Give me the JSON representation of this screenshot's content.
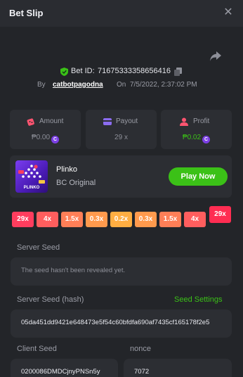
{
  "header": {
    "title": "Bet Slip"
  },
  "bet": {
    "id_label": "Bet ID:",
    "id_value": "71675333358656416",
    "by_label": "By",
    "user": "catbotpagodna",
    "on_label": "On",
    "date": "7/5/2022, 2:37:02 PM"
  },
  "stats": {
    "amount": {
      "label": "Amount",
      "value": "₱0.00"
    },
    "payout": {
      "label": "Payout",
      "value": "29 x"
    },
    "profit": {
      "label": "Profit",
      "value": "₱0.02"
    },
    "coin_glyph": "C"
  },
  "game": {
    "name": "Plinko",
    "provider": "BC Original",
    "play_label": "Play Now",
    "thumb_text": "PLINKO"
  },
  "multipliers": [
    {
      "label": "29x",
      "color": "#ff3d5e"
    },
    {
      "label": "4x",
      "color": "#ff5e5e"
    },
    {
      "label": "1.5x",
      "color": "#ff7f57"
    },
    {
      "label": "0.3x",
      "color": "#ff9a4d"
    },
    {
      "label": "0.2x",
      "color": "#ffae42"
    },
    {
      "label": "0.3x",
      "color": "#ff9a4d"
    },
    {
      "label": "1.5x",
      "color": "#ff7f57"
    },
    {
      "label": "4x",
      "color": "#ff5e5e"
    }
  ],
  "hit_multiplier": "29x",
  "seeds": {
    "server_label": "Server Seed",
    "server_value": "The seed hasn't been revealed yet.",
    "hash_label": "Server Seed (hash)",
    "settings_link": "Seed Settings",
    "hash_value": "05da451dd9421e648473e5f54c60bfdfa690af7435cf165178f2e5",
    "client_label": "Client Seed",
    "client_value": "0200086DMDCjnyPNSn5y",
    "nonce_label": "nonce",
    "nonce_value": "7072"
  },
  "colors": {
    "accent": "#3bc117",
    "profit": "#3bc117",
    "amount_icon": "#ff5470",
    "payout_icon": "#8b6cf0",
    "profit_icon": "#ff5470"
  }
}
